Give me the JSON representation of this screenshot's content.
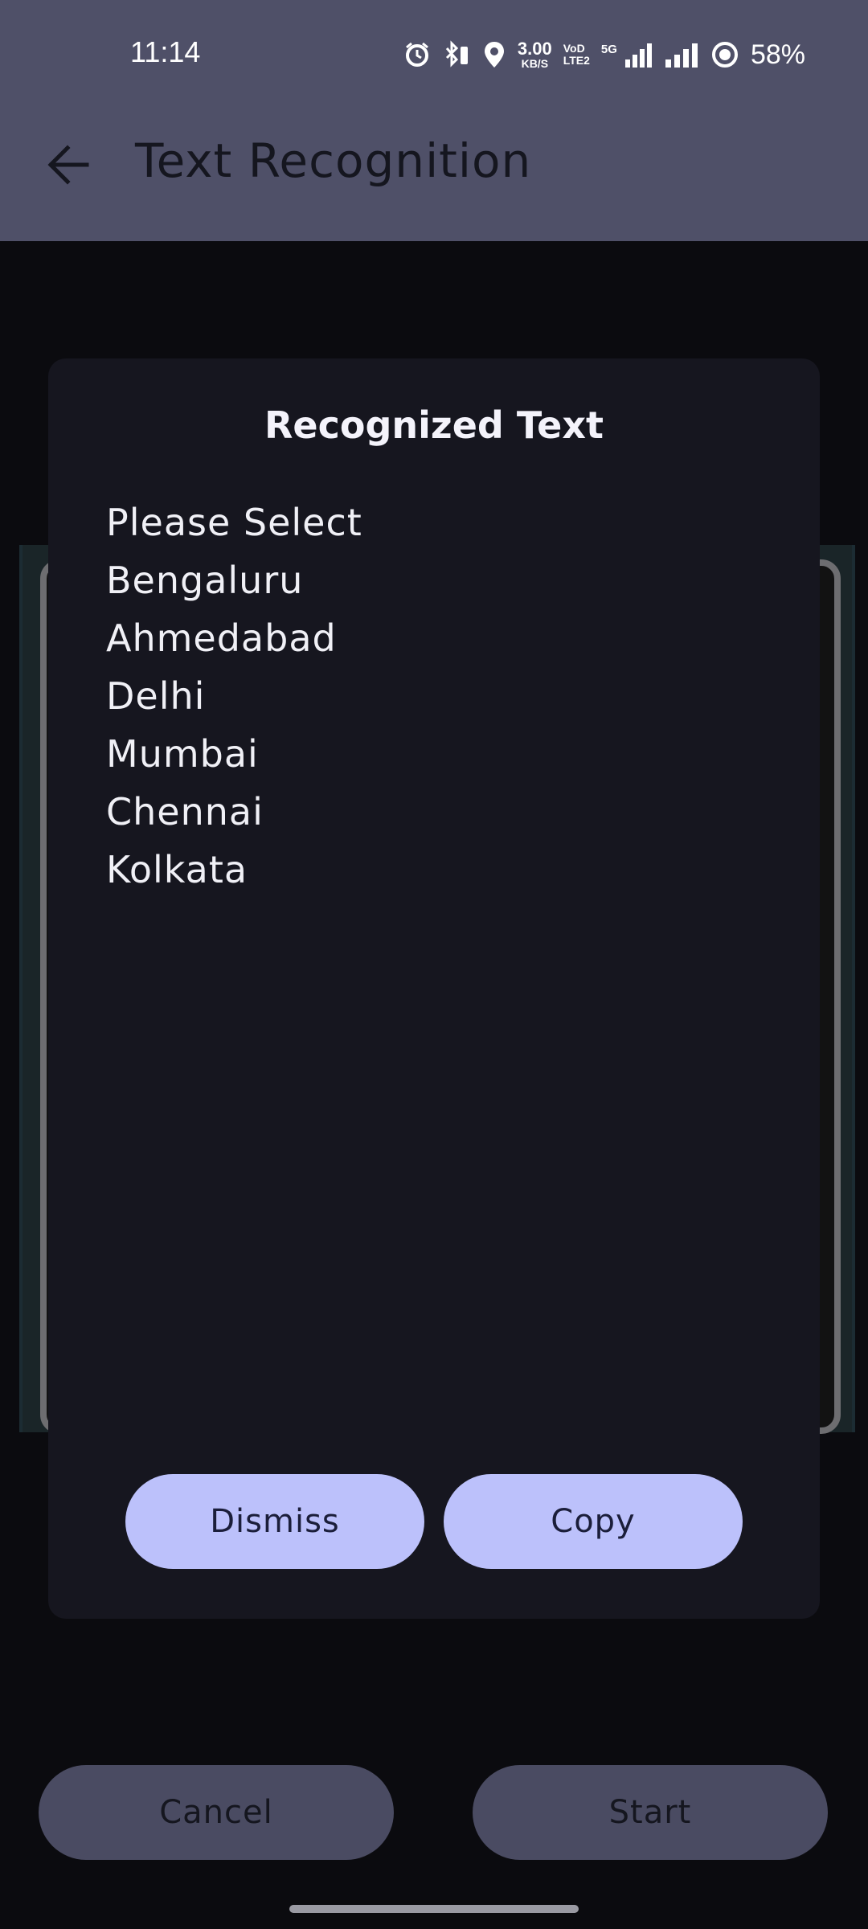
{
  "status_bar": {
    "time": "11:14",
    "net_speed_value": "3.00",
    "net_speed_unit": "KB/S",
    "volte_top": "VoD",
    "volte_bottom": "LTE2",
    "network_5g": "5G",
    "battery": "58%"
  },
  "app_bar": {
    "title": "Text Recognition"
  },
  "dialog": {
    "title": "Recognized Text",
    "lines": [
      "Please Select",
      "Bengaluru",
      "Ahmedabad",
      "Delhi",
      "Mumbai",
      "Chennai",
      "Kolkata"
    ],
    "dismiss_label": "Dismiss",
    "copy_label": "Copy"
  },
  "bottom": {
    "cancel_label": "Cancel",
    "start_label": "Start"
  },
  "colors": {
    "app_bar": "#4f5068",
    "dialog_bg": "#16161f",
    "dialog_button": "#bcc1fb",
    "bottom_button": "#4a4b62"
  }
}
